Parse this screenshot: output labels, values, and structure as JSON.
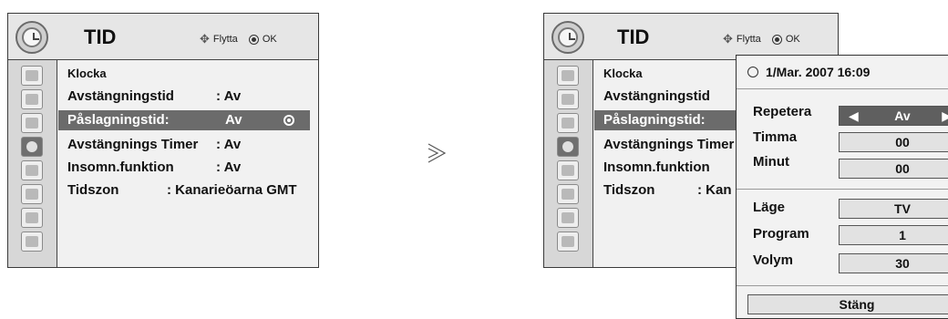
{
  "left": {
    "title": "TID",
    "nav_hint": {
      "move": "Flytta",
      "ok": "OK"
    },
    "items": [
      {
        "label": "Klocka",
        "value": ""
      },
      {
        "label": "Avstängningstid",
        "value": ": Av"
      },
      {
        "label": "Påslagningstid:",
        "value": "Av"
      },
      {
        "label": "Avstängnings Timer",
        "value": ": Av"
      },
      {
        "label": "Insomn.funktion",
        "value": ": Av"
      },
      {
        "label": "Tidszon",
        "value": ": Kanarieöarna GMT"
      }
    ],
    "selected_index": 2
  },
  "right": {
    "title": "TID",
    "nav_hint": {
      "move": "Flytta",
      "ok": "OK"
    },
    "items": [
      {
        "label": "Klocka"
      },
      {
        "label": "Avstängningstid"
      },
      {
        "label": "Påslagningstid:"
      },
      {
        "label": "Avstängnings Timer"
      },
      {
        "label": "Insomn.funktion"
      },
      {
        "label": "Tidszon",
        "value": ": Kan"
      }
    ],
    "selected_index": 2
  },
  "sidebar_icons": [
    "picture-icon",
    "screen-icon",
    "audio-icon",
    "clock-icon",
    "option-icon",
    "lock-icon",
    "input-icon",
    "usb-icon"
  ],
  "active_icon_index": 3,
  "popup": {
    "datetime": "1/Mar. 2007 16:09",
    "fields": [
      {
        "label": "Repetera",
        "value": "Av",
        "arrows": true
      },
      {
        "label": "Timma",
        "value": "00"
      },
      {
        "label": "Minut",
        "value": "00"
      },
      {
        "label": "Läge",
        "value": "TV"
      },
      {
        "label": "Program",
        "value": "1"
      },
      {
        "label": "Volym",
        "value": "30"
      }
    ],
    "close_label": "Stäng"
  },
  "arrow_glyph": "≫",
  "colors": {
    "highlight": "#6b6b6b",
    "panel_bg": "#f1f1f1",
    "border": "#3a3a3a"
  }
}
